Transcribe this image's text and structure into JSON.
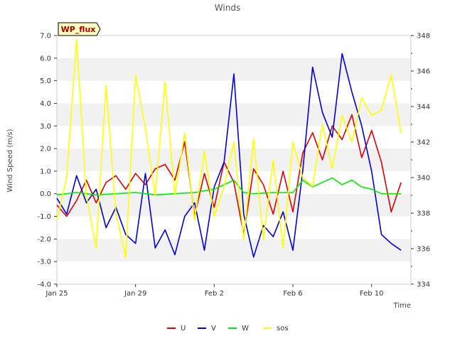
{
  "chart_data": {
    "type": "line",
    "title": "Winds",
    "xlabel": "Time",
    "ylabel": "Wind Speed (m/s)",
    "badge": "WP_flux",
    "x_range": [
      "2025-01-25",
      "2025-02-12"
    ],
    "x_ticks": [
      {
        "date": "2025-01-25",
        "label": "Jan 25"
      },
      {
        "date": "2025-01-29",
        "label": "Jan 29"
      },
      {
        "date": "2025-02-02",
        "label": "Feb 2"
      },
      {
        "date": "2025-02-06",
        "label": "Feb 6"
      },
      {
        "date": "2025-02-10",
        "label": "Feb 10"
      }
    ],
    "ylim": [
      -4.0,
      7.0
    ],
    "y_ticks": [
      "-4.0",
      "-3.0",
      "-2.0",
      "-1.0",
      "0.0",
      "1.0",
      "2.0",
      "3.0",
      "4.0",
      "5.0",
      "6.0",
      "7.0"
    ],
    "y2lim": [
      334,
      348
    ],
    "y2_ticks": [
      "334",
      "336",
      "338",
      "340",
      "342",
      "344",
      "346",
      "348"
    ],
    "grid": "horizontal bands",
    "legend_position": "bottom-center",
    "series": [
      {
        "name": "U",
        "color": "#e00000",
        "axis": "left",
        "points": [
          [
            "2025-01-25",
            -0.5
          ],
          [
            "2025-01-25T12:00",
            -1.0
          ],
          [
            "2025-01-26",
            -0.3
          ],
          [
            "2025-01-26T12:00",
            0.6
          ],
          [
            "2025-01-27",
            -0.4
          ],
          [
            "2025-01-27T12:00",
            0.5
          ],
          [
            "2025-01-28",
            0.8
          ],
          [
            "2025-01-28T12:00",
            0.2
          ],
          [
            "2025-01-29",
            0.9
          ],
          [
            "2025-01-29T12:00",
            0.4
          ],
          [
            "2025-01-30",
            1.1
          ],
          [
            "2025-01-30T12:00",
            1.3
          ],
          [
            "2025-01-31",
            0.6
          ],
          [
            "2025-01-31T12:00",
            2.3
          ],
          [
            "2025-02-01",
            -1.0
          ],
          [
            "2025-02-01T12:00",
            0.9
          ],
          [
            "2025-02-02",
            -0.6
          ],
          [
            "2025-02-02T12:00",
            1.4
          ],
          [
            "2025-02-03",
            0.5
          ],
          [
            "2025-02-03T12:00",
            -1.8
          ],
          [
            "2025-02-04",
            1.1
          ],
          [
            "2025-02-04T12:00",
            0.4
          ],
          [
            "2025-02-05",
            -0.9
          ],
          [
            "2025-02-05T12:00",
            1.0
          ],
          [
            "2025-02-06",
            -0.8
          ],
          [
            "2025-02-06T12:00",
            1.8
          ],
          [
            "2025-02-07",
            2.7
          ],
          [
            "2025-02-07T12:00",
            1.5
          ],
          [
            "2025-02-08",
            3.0
          ],
          [
            "2025-02-08T12:00",
            2.4
          ],
          [
            "2025-02-09",
            3.5
          ],
          [
            "2025-02-09T12:00",
            1.6
          ],
          [
            "2025-02-10",
            2.8
          ],
          [
            "2025-02-10T12:00",
            1.4
          ],
          [
            "2025-02-11",
            -0.8
          ],
          [
            "2025-02-11T12:00",
            0.5
          ]
        ]
      },
      {
        "name": "V",
        "color": "#0000dd",
        "axis": "left",
        "points": [
          [
            "2025-01-25",
            -0.2
          ],
          [
            "2025-01-25T12:00",
            -0.9
          ],
          [
            "2025-01-26",
            0.8
          ],
          [
            "2025-01-26T12:00",
            -0.4
          ],
          [
            "2025-01-27",
            0.2
          ],
          [
            "2025-01-27T12:00",
            -1.5
          ],
          [
            "2025-01-28",
            -0.6
          ],
          [
            "2025-01-28T12:00",
            -1.8
          ],
          [
            "2025-01-29",
            -2.2
          ],
          [
            "2025-01-29T12:00",
            0.9
          ],
          [
            "2025-01-30",
            -2.4
          ],
          [
            "2025-01-30T12:00",
            -1.6
          ],
          [
            "2025-01-31",
            -2.7
          ],
          [
            "2025-01-31T12:00",
            -1.0
          ],
          [
            "2025-02-01",
            -0.4
          ],
          [
            "2025-02-01T12:00",
            -2.5
          ],
          [
            "2025-02-02",
            0.3
          ],
          [
            "2025-02-02T12:00",
            1.4
          ],
          [
            "2025-02-03",
            5.3
          ],
          [
            "2025-02-03T12:00",
            -0.9
          ],
          [
            "2025-02-04",
            -2.8
          ],
          [
            "2025-02-04T12:00",
            -1.4
          ],
          [
            "2025-02-05",
            -1.9
          ],
          [
            "2025-02-05T12:00",
            -0.8
          ],
          [
            "2025-02-06",
            -2.5
          ],
          [
            "2025-02-06T12:00",
            1.0
          ],
          [
            "2025-02-07",
            5.6
          ],
          [
            "2025-02-07T12:00",
            3.6
          ],
          [
            "2025-02-08",
            2.5
          ],
          [
            "2025-02-08T12:00",
            6.2
          ],
          [
            "2025-02-09",
            4.5
          ],
          [
            "2025-02-09T12:00",
            3.0
          ],
          [
            "2025-02-10",
            1.0
          ],
          [
            "2025-02-10T12:00",
            -1.8
          ],
          [
            "2025-02-11",
            -2.2
          ],
          [
            "2025-02-11T12:00",
            -2.5
          ]
        ]
      },
      {
        "name": "W",
        "color": "#00ee00",
        "axis": "left",
        "points": [
          [
            "2025-01-25",
            -0.05
          ],
          [
            "2025-01-26",
            0.05
          ],
          [
            "2025-01-27",
            -0.05
          ],
          [
            "2025-01-28",
            0.0
          ],
          [
            "2025-01-29",
            0.05
          ],
          [
            "2025-01-30",
            -0.05
          ],
          [
            "2025-01-31",
            0.0
          ],
          [
            "2025-02-01",
            0.05
          ],
          [
            "2025-02-02",
            0.2
          ],
          [
            "2025-02-02T12:00",
            0.4
          ],
          [
            "2025-02-03",
            0.6
          ],
          [
            "2025-02-03T12:00",
            0.05
          ],
          [
            "2025-02-04",
            0.0
          ],
          [
            "2025-02-05",
            0.05
          ],
          [
            "2025-02-06",
            0.05
          ],
          [
            "2025-02-06T12:00",
            0.6
          ],
          [
            "2025-02-07",
            0.3
          ],
          [
            "2025-02-07T12:00",
            0.5
          ],
          [
            "2025-02-08",
            0.7
          ],
          [
            "2025-02-08T12:00",
            0.4
          ],
          [
            "2025-02-09",
            0.6
          ],
          [
            "2025-02-09T12:00",
            0.3
          ],
          [
            "2025-02-10",
            0.2
          ],
          [
            "2025-02-10T12:00",
            0.0
          ],
          [
            "2025-02-11",
            0.0
          ],
          [
            "2025-02-11T12:00",
            0.0
          ]
        ]
      },
      {
        "name": "sos",
        "color": "#ffff00",
        "axis": "right",
        "points": [
          [
            "2025-01-25",
            337.6
          ],
          [
            "2025-01-25T12:00",
            340.0
          ],
          [
            "2025-01-26",
            347.8
          ],
          [
            "2025-01-26T12:00",
            339.0
          ],
          [
            "2025-01-27",
            336.0
          ],
          [
            "2025-01-27T12:00",
            345.2
          ],
          [
            "2025-01-28",
            338.0
          ],
          [
            "2025-01-28T12:00",
            335.5
          ],
          [
            "2025-01-29",
            345.8
          ],
          [
            "2025-01-29T12:00",
            342.8
          ],
          [
            "2025-01-30",
            339.0
          ],
          [
            "2025-01-30T12:00",
            345.4
          ],
          [
            "2025-01-31",
            339.0
          ],
          [
            "2025-01-31T12:00",
            342.5
          ],
          [
            "2025-02-01",
            337.6
          ],
          [
            "2025-02-01T12:00",
            341.5
          ],
          [
            "2025-02-02",
            337.8
          ],
          [
            "2025-02-02T12:00",
            339.5
          ],
          [
            "2025-02-03",
            342.0
          ],
          [
            "2025-02-03T12:00",
            336.5
          ],
          [
            "2025-02-04",
            342.2
          ],
          [
            "2025-02-04T12:00",
            336.5
          ],
          [
            "2025-02-05",
            341.0
          ],
          [
            "2025-02-05T12:00",
            336.0
          ],
          [
            "2025-02-06",
            342.0
          ],
          [
            "2025-02-06T12:00",
            340.0
          ],
          [
            "2025-02-07",
            339.5
          ],
          [
            "2025-02-07T12:00",
            343.0
          ],
          [
            "2025-02-08",
            340.5
          ],
          [
            "2025-02-08T12:00",
            343.5
          ],
          [
            "2025-02-09",
            342.0
          ],
          [
            "2025-02-09T12:00",
            344.5
          ],
          [
            "2025-02-10",
            343.5
          ],
          [
            "2025-02-10T12:00",
            343.8
          ],
          [
            "2025-02-11",
            345.8
          ],
          [
            "2025-02-11T12:00",
            342.5
          ]
        ]
      }
    ]
  }
}
